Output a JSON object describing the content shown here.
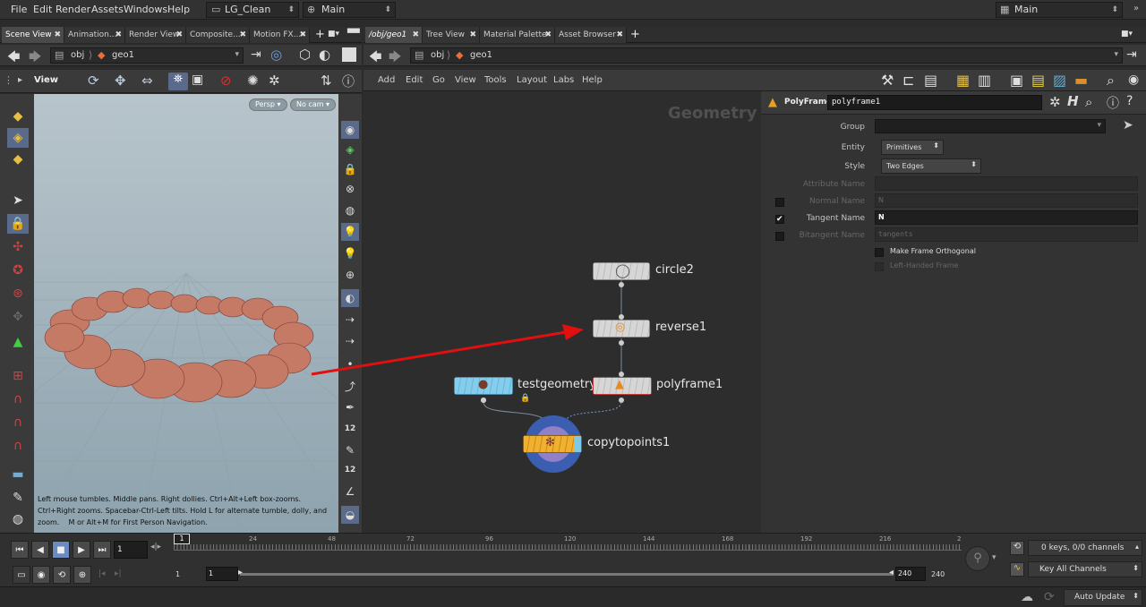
{
  "menubar": {
    "items": [
      "File",
      "Edit",
      "Render",
      "Assets",
      "Windows",
      "Help"
    ],
    "desktop": "LG_Clean",
    "context": "Main",
    "right_context": "Main"
  },
  "left_pane": {
    "tabs": [
      "Scene View",
      "Animation...",
      "Render View",
      "Composite...",
      "Motion FX..."
    ],
    "path": {
      "root": "obj",
      "node": "geo1"
    },
    "viewer_label": "View",
    "persp_label": "Persp",
    "cam_label": "No cam",
    "help_text_1": "Left mouse tumbles. Middle pans. Right dollies. Ctrl+Alt+Left box-zooms.",
    "help_text_2": "Ctrl+Right zooms. Spacebar-Ctrl-Left tilts. Hold L for alternate tumble, dolly, and",
    "help_text_3": "zoom.    M or Alt+M for First Person Navigation.",
    "tool_labels": [
      "12",
      "12"
    ]
  },
  "network": {
    "tabs": [
      "/obj/geo1",
      "Tree View",
      "Material Palette",
      "Asset Browser"
    ],
    "path": {
      "root": "obj",
      "node": "geo1"
    },
    "menu": [
      "Add",
      "Edit",
      "Go",
      "View",
      "Tools",
      "Layout",
      "Labs",
      "Help"
    ],
    "context_label": "Geometry",
    "nodes": {
      "circle": "circle2",
      "reverse": "reverse1",
      "testgeo": "testgeometry",
      "polyframe": "polyframe1",
      "copy": "copytopoints1"
    }
  },
  "params": {
    "node_type": "PolyFrame",
    "node_name": "polyframe1",
    "group_label": "Group",
    "entity_label": "Entity",
    "entity_value": "Primitives",
    "style_label": "Style",
    "style_value": "Two Edges",
    "attribute_name_label": "Attribute Name",
    "normal_name_label": "Normal Name",
    "normal_name_value": "N",
    "tangent_name_label": "Tangent Name",
    "tangent_name_value": "N",
    "bitangent_name_label": "Bitangent Name",
    "bitangent_name_value": "tangents",
    "orthogonal_label": "Make Frame Orthogonal",
    "lefthanded_label": "Left-Handed Frame"
  },
  "timeline": {
    "frame_current": "1",
    "frame_marker": "1",
    "ticks": [
      "24",
      "48",
      "72",
      "96",
      "120",
      "144",
      "168",
      "192",
      "216",
      "2"
    ],
    "start": "1",
    "start2": "1",
    "end": "240",
    "end2": "240",
    "channels_text": "0 keys, 0/0 channels",
    "key_all": "Key All Channels",
    "auto_update": "Auto Update"
  },
  "colors": {
    "accent": "#e5a020",
    "testgeo": "#7ec8e8",
    "copy_ring": "#3b5eb0",
    "arrow": "#e01010"
  }
}
